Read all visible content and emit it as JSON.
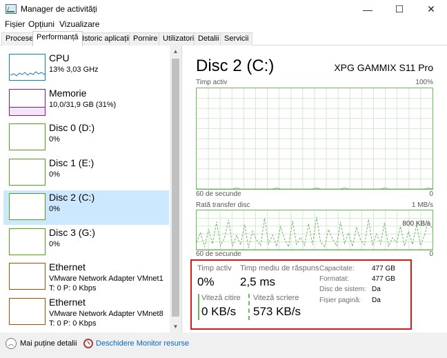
{
  "window": {
    "title": "Manager de activități",
    "minimize_glyph": "—",
    "maximize_glyph": "☐",
    "close_glyph": "✕"
  },
  "menu": [
    "Fișier",
    "Opțiuni",
    "Vizualizare"
  ],
  "tabs": [
    "Procese",
    "Performanță",
    "Istoric aplicații",
    "Pornire",
    "Utilizatori",
    "Detalii",
    "Servicii"
  ],
  "active_tab": "Performanță",
  "resources": [
    {
      "name": "CPU",
      "sub": "13% 3,03 GHz",
      "sub2": "",
      "color": "#117dbb"
    },
    {
      "name": "Memorie",
      "sub": "10,0/31,9 GB (31%)",
      "sub2": "",
      "color": "#8b12ae"
    },
    {
      "name": "Disc 0 (D:)",
      "sub": "0%",
      "sub2": "",
      "color": "#4da60c"
    },
    {
      "name": "Disc 1 (E:)",
      "sub": "0%",
      "sub2": "",
      "color": "#4da60c"
    },
    {
      "name": "Disc 2 (C:)",
      "sub": "0%",
      "sub2": "",
      "color": "#4da60c"
    },
    {
      "name": "Disc 3 (G:)",
      "sub": "0%",
      "sub2": "",
      "color": "#4da60c"
    },
    {
      "name": "Ethernet",
      "sub": "VMware Network Adapter VMnet1",
      "sub2": "T: 0 P: 0 Kbps",
      "color": "#a74f01"
    },
    {
      "name": "Ethernet",
      "sub": "VMware Network Adapter VMnet8",
      "sub2": "T: 0 P: 0 Kbps",
      "color": "#a74f01"
    }
  ],
  "selected_resource": "Disc 2 (C:)",
  "scroll": {
    "up_glyph": "▲",
    "down_glyph": "▼"
  },
  "detail": {
    "title": "Disc 2 (C:)",
    "model": "XPG GAMMIX S11 Pro",
    "graph1": {
      "label": "Timp activ",
      "max_label": "100%",
      "time_label": "60 de secunde",
      "min_label": "0",
      "values": [
        0,
        0,
        0,
        0,
        0,
        0,
        0,
        0,
        0,
        0,
        1,
        0,
        0,
        0,
        0,
        0,
        0,
        0,
        0,
        0,
        1,
        0,
        0,
        0,
        0,
        0,
        0,
        0,
        0,
        0,
        1,
        0,
        0,
        0,
        0,
        0,
        0,
        1,
        0,
        0,
        0,
        0,
        0,
        0,
        0,
        0,
        0,
        1,
        0,
        0,
        0,
        0,
        0,
        0,
        0,
        0,
        0,
        0,
        1,
        0
      ]
    },
    "graph2": {
      "label": "Rată transfer disc",
      "max_label": "1 MB/s",
      "scale_label": "800 KB/s",
      "time_label": "60 de secunde",
      "min_label": "0",
      "write_kbs": [
        150,
        350,
        60,
        420,
        120,
        580,
        80,
        250,
        620,
        70,
        300,
        100,
        520,
        40,
        380,
        200,
        90,
        650,
        120,
        300,
        70,
        480,
        220,
        60,
        600,
        110,
        260,
        90,
        540,
        100,
        680,
        160,
        60,
        420,
        220,
        80,
        580,
        130,
        350,
        70,
        470,
        200,
        100,
        630,
        90,
        330,
        120,
        560,
        70,
        250,
        150,
        480,
        80,
        380,
        110,
        520,
        90,
        300,
        600,
        420
      ],
      "read_kbs": [
        0,
        0,
        0,
        0,
        0,
        0,
        0,
        0,
        0,
        0,
        0,
        0,
        0,
        0,
        0,
        0,
        0,
        0,
        0,
        0,
        0,
        0,
        0,
        0,
        0,
        0,
        0,
        0,
        0,
        0,
        0,
        0,
        0,
        0,
        0,
        0,
        0,
        0,
        0,
        0,
        0,
        0,
        0,
        0,
        0,
        0,
        0,
        0,
        0,
        0,
        0,
        0,
        0,
        0,
        0,
        0,
        0,
        0,
        0,
        0
      ]
    },
    "stats": {
      "active_time_label": "Timp activ",
      "active_time_value": "0%",
      "avg_response_label": "Timp mediu de răspuns",
      "avg_response_value": "2,5 ms",
      "read_speed_label": "Viteză citire",
      "read_speed_value": "0 KB/s",
      "write_speed_label": "Viteză scriere",
      "write_speed_value": "573 KB/s",
      "props": [
        {
          "key": "Capacitate:",
          "value": "477 GB"
        },
        {
          "key": "Formatat:",
          "value": "477 GB"
        },
        {
          "key": "Disc de sistem:",
          "value": "Da"
        },
        {
          "key": "Fișier pagină:",
          "value": "Da"
        }
      ]
    }
  },
  "footer": {
    "less_details": "Mai puține detalii",
    "open_monitor": "Deschidere Monitor resurse",
    "chevron_glyph": "︿"
  },
  "colors": {
    "disk_line": "#6cb65f",
    "disk_fill": "#e8f3e4",
    "disk_grid": "#d3ead0",
    "highlight_border": "#e01616",
    "selection": "#cce8ff"
  }
}
